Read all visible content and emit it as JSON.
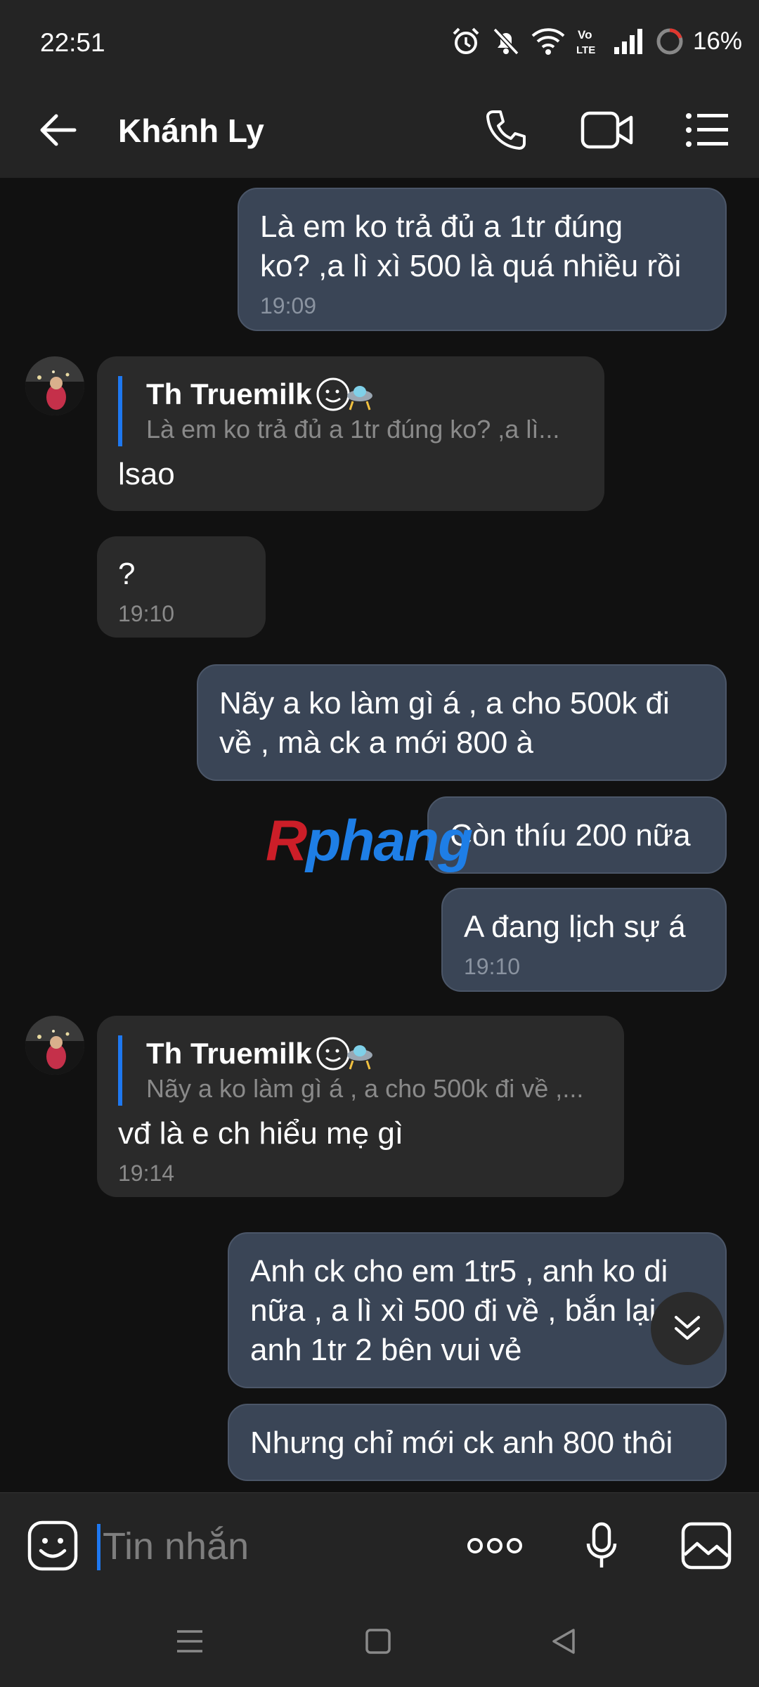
{
  "status_bar": {
    "time": "22:51",
    "battery": "16%",
    "volte_label_top": "Vo",
    "volte_label_bottom": "LTE",
    "icons": [
      "alarm-icon",
      "mute-icon",
      "wifi-icon",
      "volte-icon",
      "signal-icon",
      "battery-ring-icon"
    ]
  },
  "header": {
    "contact_name": "Khánh Ly",
    "icons": [
      "back-arrow-icon",
      "phone-icon",
      "video-icon",
      "menu-list-icon"
    ]
  },
  "messages": [
    {
      "side": "out",
      "text": "Là em ko trả đủ a 1tr đúng\nko? ,a lì xì 500 là quá nhiều rồi",
      "time": "19:09"
    },
    {
      "side": "in",
      "reply_name": "Th Truemilk",
      "reply_snippet": "Là em ko trả đủ a 1tr đúng ko? ,a lì...",
      "text": "lsao",
      "time": ""
    },
    {
      "side": "in",
      "text": "?",
      "time": "19:10"
    },
    {
      "side": "out",
      "text": "Nãy a ko làm gì á , a cho 500k đi\nvề , mà ck a mới 800 à",
      "time": ""
    },
    {
      "side": "out",
      "text": "Còn thíu 200 nữa",
      "time": ""
    },
    {
      "side": "out",
      "text": "A đang lịch sự á",
      "time": "19:10"
    },
    {
      "side": "in",
      "reply_name": "Th Truemilk",
      "reply_snippet": "Nãy a ko làm gì á , a cho 500k đi về ,...",
      "text": "vđ là e ch hiểu mẹ gì",
      "time": "19:14"
    },
    {
      "side": "out",
      "text": "Anh ck cho em 1tr5 , anh ko di\nnữa , a lì xì 500 đi về , bắn lại\nanh 1tr 2 bên vui vẻ",
      "time": ""
    },
    {
      "side": "out",
      "text": "Nhưng chỉ mới ck anh 800 thôi",
      "time": ""
    }
  ],
  "watermark": {
    "first": "R",
    "rest": "phang"
  },
  "composer": {
    "placeholder": "Tin nhắn",
    "value": ""
  },
  "colors": {
    "background": "#111111",
    "bar": "#242424",
    "outgoing_bubble": "#3a4556",
    "incoming_bubble": "#2a2a2a",
    "accent": "#1e78f0"
  }
}
